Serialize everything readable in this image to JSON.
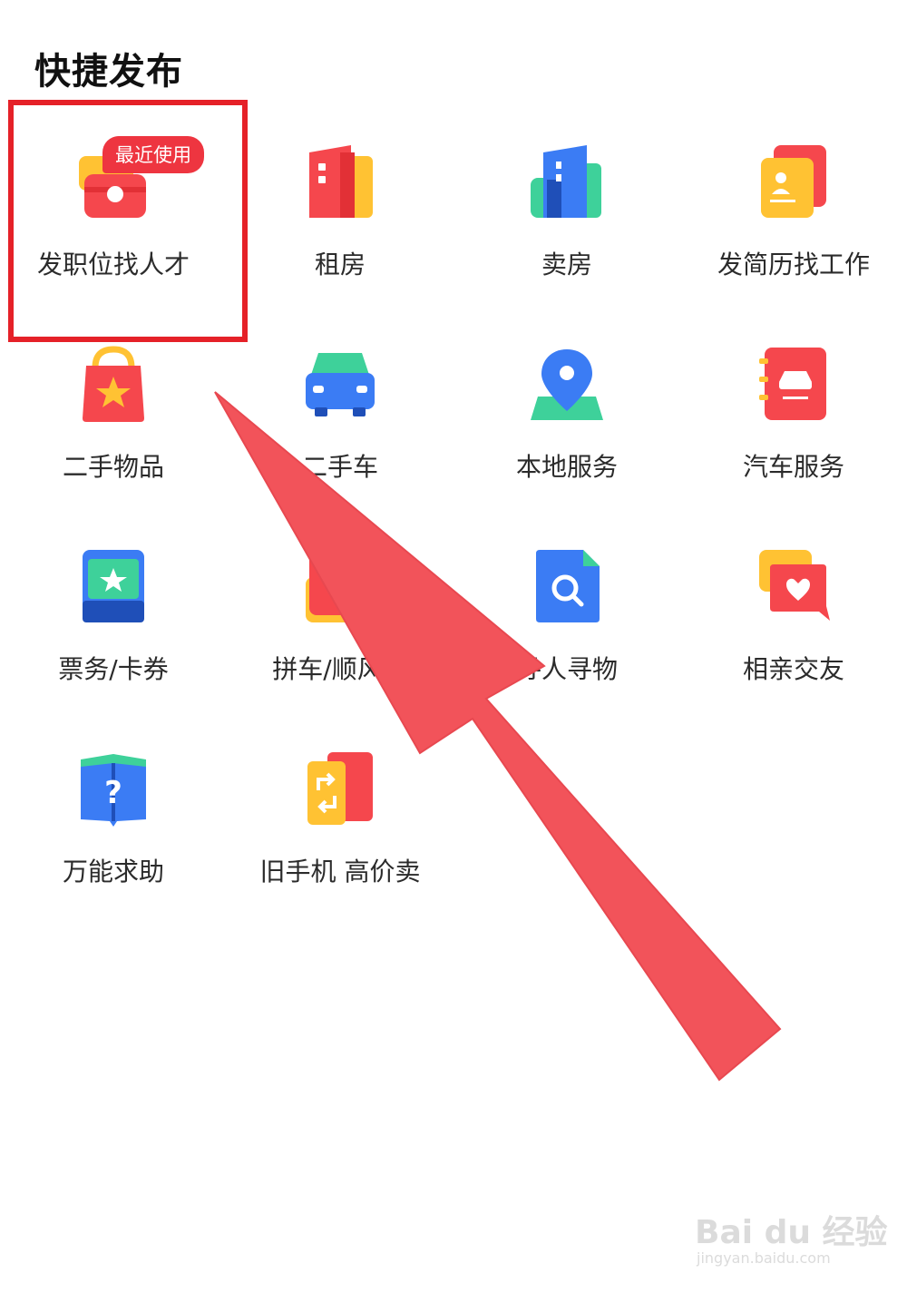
{
  "page_title": "快捷发布",
  "recent_badge": "最近使用",
  "items": [
    {
      "label": "发职位找人才",
      "icon": "job-briefcase-icon"
    },
    {
      "label": "租房",
      "icon": "rent-building-icon"
    },
    {
      "label": "卖房",
      "icon": "sell-building-icon"
    },
    {
      "label": "发简历找工作",
      "icon": "resume-icon"
    },
    {
      "label": "二手物品",
      "icon": "shopping-bag-icon"
    },
    {
      "label": "二手车",
      "icon": "car-icon"
    },
    {
      "label": "本地服务",
      "icon": "location-pin-icon"
    },
    {
      "label": "汽车服务",
      "icon": "car-service-book-icon"
    },
    {
      "label": "票务/卡券",
      "icon": "ticket-icon"
    },
    {
      "label": "拼车/顺风车",
      "icon": "carpool-icon"
    },
    {
      "label": "寻人寻物",
      "icon": "search-document-icon"
    },
    {
      "label": "相亲交友",
      "icon": "chat-heart-icon"
    },
    {
      "label": "万能求助",
      "icon": "help-book-icon"
    },
    {
      "label": "旧手机 高价卖",
      "icon": "phone-trade-icon"
    }
  ],
  "watermark": {
    "brand": "Bai du 经验",
    "url": "jingyan.baidu.com"
  },
  "colors": {
    "highlight": "#e52128",
    "arrow": "#f2535a",
    "badge": "#ee3540"
  }
}
